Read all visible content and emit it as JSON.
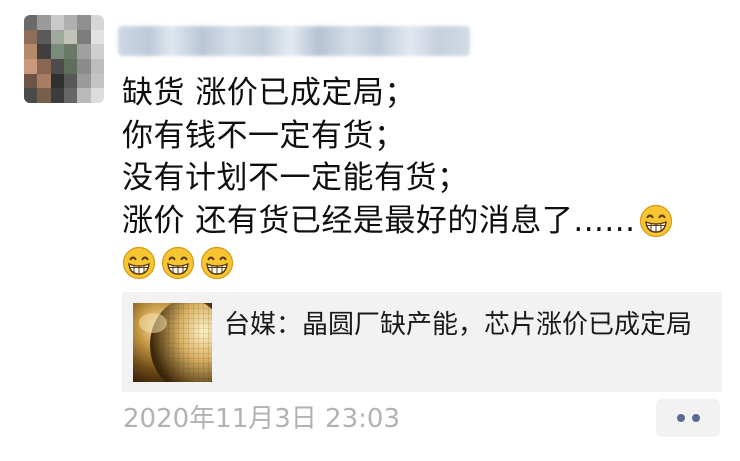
{
  "post": {
    "author": {
      "name_obscured": true,
      "avatar_obscured": true
    },
    "text_lines": [
      "缺货  涨价已成定局；",
      "你有钱不一定有货；",
      "没有计划不一定能有货；",
      "涨价 还有货已经是最好的消息了......"
    ],
    "emoji_icon": "grinning-face-icon",
    "emoji_count_inline": 1,
    "emoji_count_next_line": 3,
    "link_card": {
      "title": "台媒：晶圆厂缺产能，芯片涨价已成定局",
      "thumbnail_icon": "wafer-thumbnail"
    },
    "timestamp": "2020年11月3日 23:03",
    "more_button_icon": "more-dots-icon"
  },
  "colors": {
    "text": "#0f0f0f",
    "timestamp": "#b2b2b2",
    "card_background": "#f2f2f2",
    "more_dots": "#5b6b91"
  }
}
